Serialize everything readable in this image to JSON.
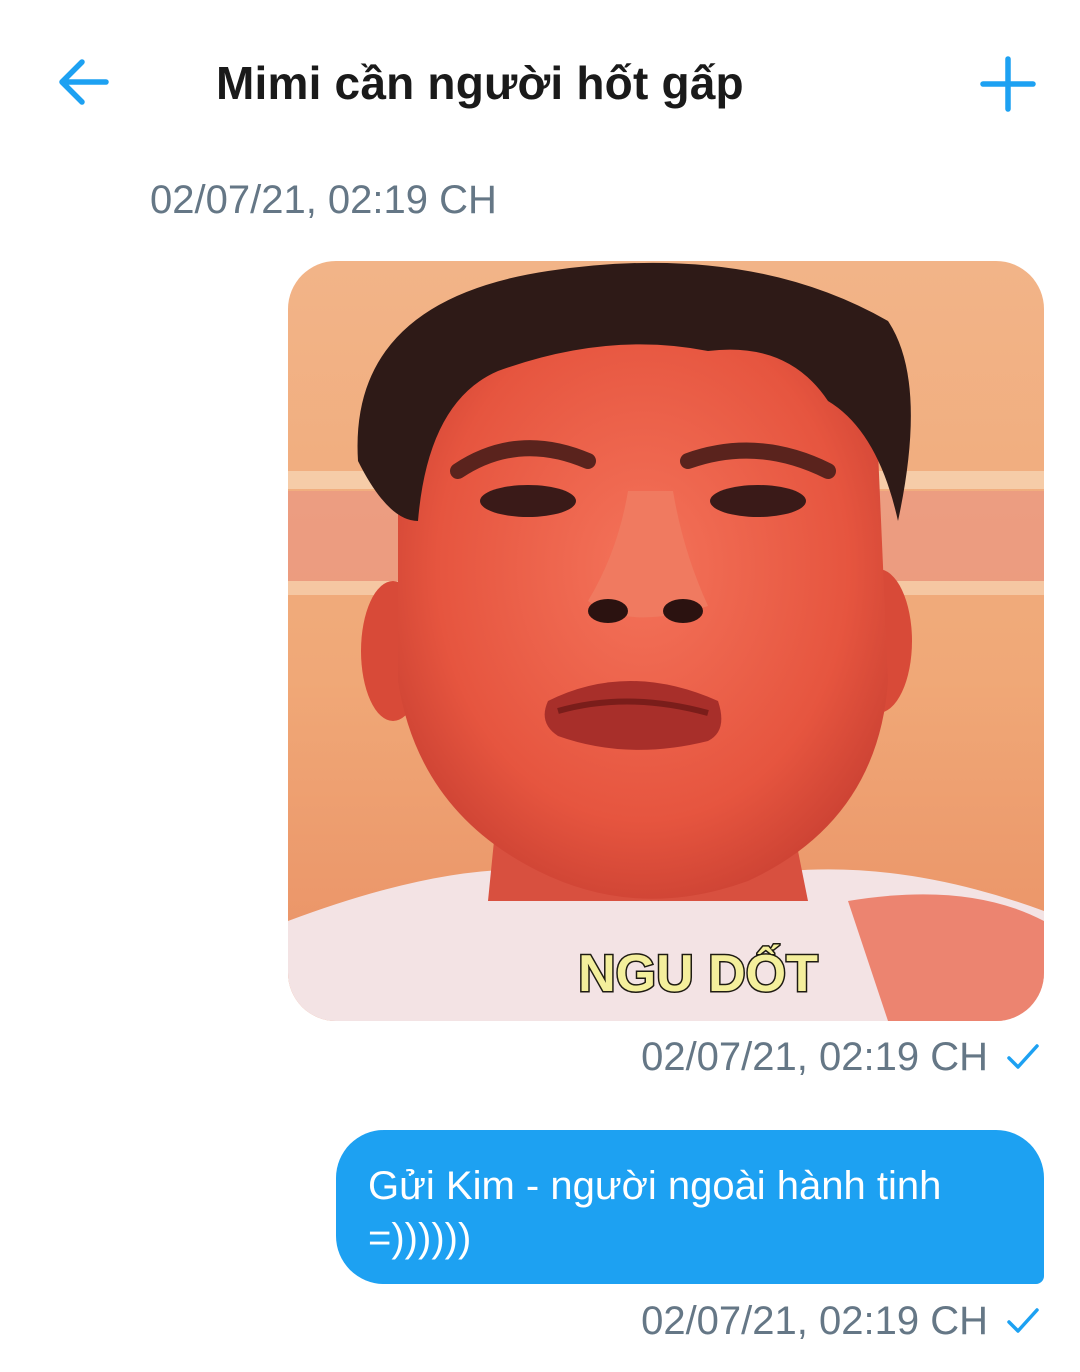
{
  "header": {
    "title": "Mimi cần người hốt gấp",
    "back_icon": "arrow-left-icon",
    "add_icon": "plus-icon",
    "accent_color": "#1da1f2"
  },
  "conversation": {
    "top_timestamp": "02/07/21, 02:19 CH",
    "messages": [
      {
        "type": "image",
        "caption_overlay": "NGU DỐT",
        "timestamp": "02/07/21, 02:19 CH",
        "status_icon": "check-icon"
      },
      {
        "type": "text",
        "lines": [
          "Gửi Kim - người ngoài hành tinh",
          "=))))))"
        ],
        "timestamp": "02/07/21, 02:19 CH",
        "status_icon": "check-icon",
        "bubble_color": "#1da1f2"
      }
    ]
  }
}
